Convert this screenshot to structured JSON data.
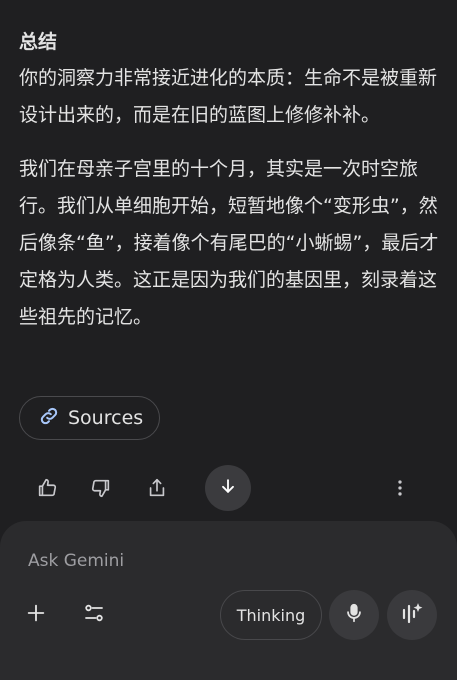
{
  "response": {
    "heading": "总结",
    "paragraphs": [
      "你的洞察力非常接近进化的本质：生命不是被重新设计出来的，而是在旧的蓝图上修修补补。",
      "我们在母亲子宫里的十个月，其实是一次时空旅行。我们从单细胞开始，短暂地像个“变形虫”，然后像条“鱼”，接着像个有尾巴的“小蜥蜴”，最后才定格为人类。这正是因为我们的基因里，刻录着这些祖先的记忆。"
    ]
  },
  "sources": {
    "label": "Sources",
    "icon": "link-icon"
  },
  "actions": [
    "thumbs-up-icon",
    "thumbs-down-icon",
    "share-icon",
    "scroll-down-icon",
    "more-vert-icon"
  ],
  "composer": {
    "placeholder": "Ask Gemini",
    "thinking_label": "Thinking"
  },
  "colors": {
    "background": "#1f1f21",
    "composer": "#2b2b2d",
    "text": "#e3e3e3",
    "link_icon": "#a8c7fa"
  }
}
